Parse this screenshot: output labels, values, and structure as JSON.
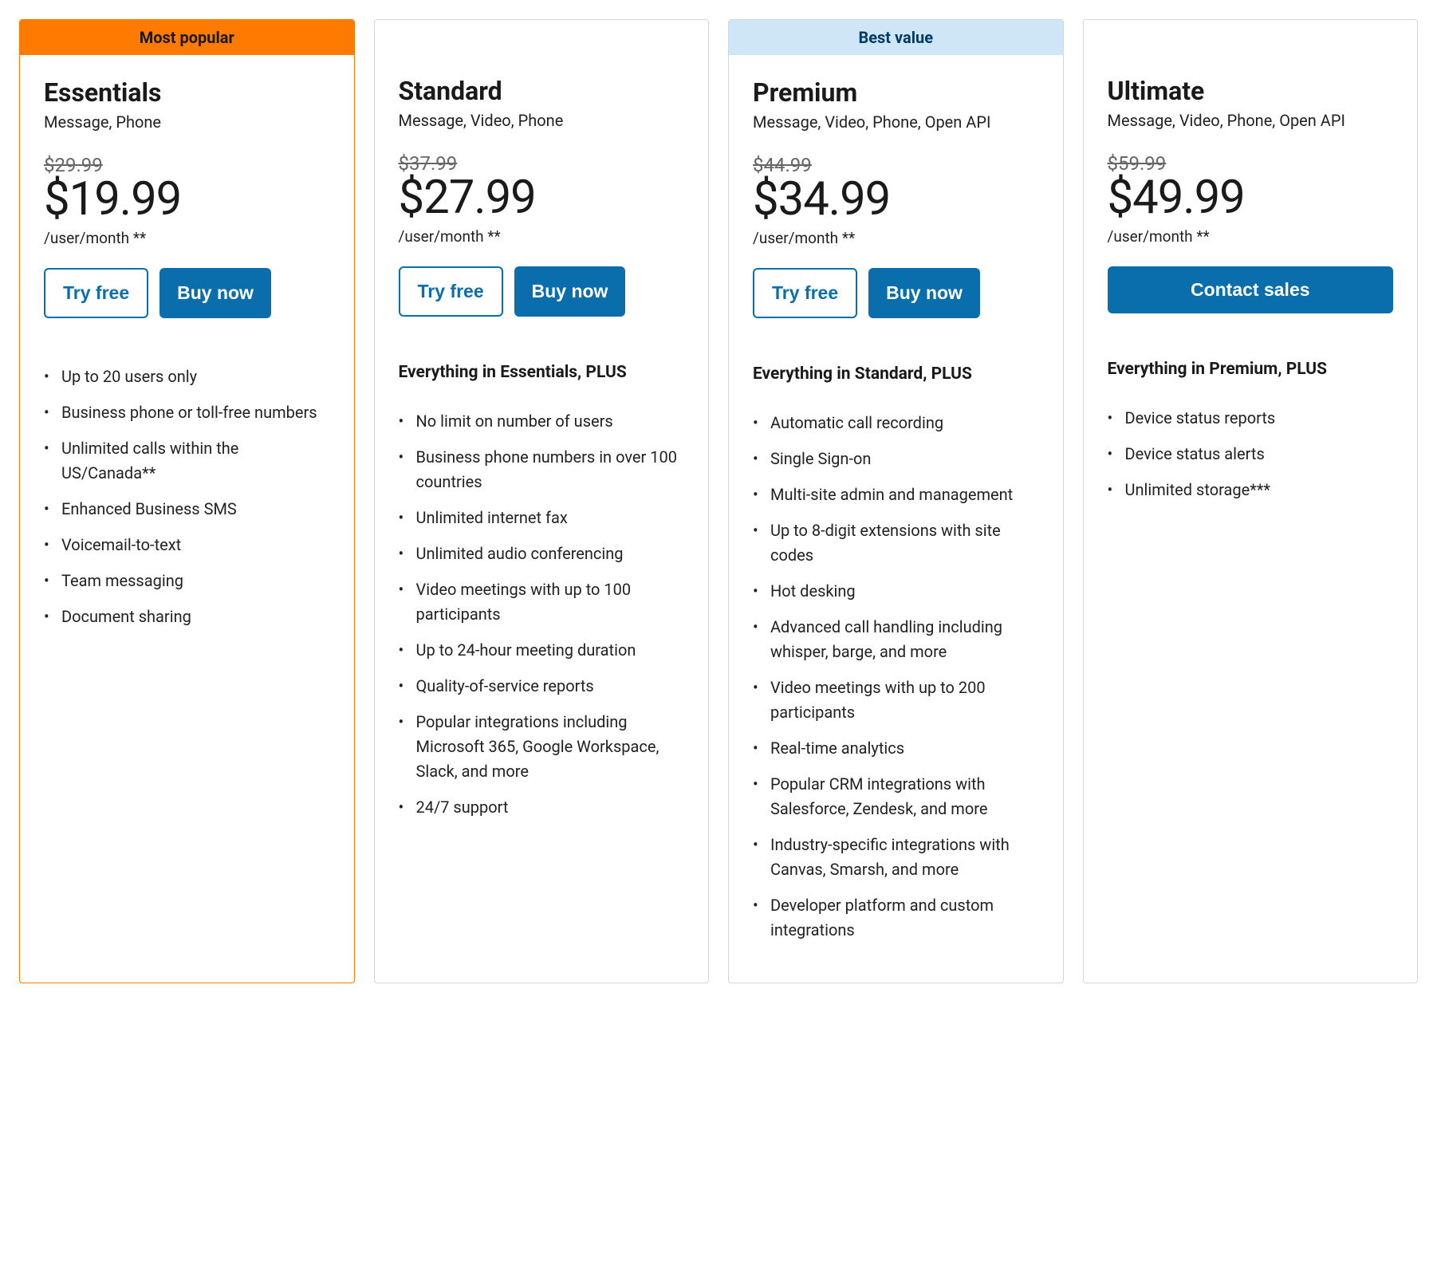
{
  "plans": [
    {
      "badge": "Most popular",
      "badge_style": "orange",
      "highlight": true,
      "name": "Essentials",
      "tagline": "Message, Phone",
      "old_price": "$29.99",
      "price": "$19.99",
      "price_unit": "/user/month **",
      "try_label": "Try free",
      "buy_label": "Buy now",
      "contact_label": "",
      "plus_heading": "",
      "features": [
        "Up to 20 users only",
        "Business phone or toll-free numbers",
        "Unlimited calls within the US/Canada**",
        "Enhanced Business SMS",
        "Voicemail-to-text",
        "Team messaging",
        "Document sharing"
      ]
    },
    {
      "badge": "",
      "badge_style": "",
      "highlight": false,
      "name": "Standard",
      "tagline": "Message, Video, Phone",
      "old_price": "$37.99",
      "price": "$27.99",
      "price_unit": "/user/month **",
      "try_label": "Try free",
      "buy_label": "Buy now",
      "contact_label": "",
      "plus_heading": "Everything in Essentials, PLUS",
      "features": [
        "No limit on number of users",
        "Business phone numbers in over 100 countries",
        "Unlimited internet fax",
        "Unlimited audio conferencing",
        "Video meetings with up to 100 participants",
        "Up to 24-hour meeting duration",
        "Quality-of-service reports",
        "Popular integrations including Microsoft 365, Google Workspace, Slack, and more",
        "24/7 support"
      ]
    },
    {
      "badge": "Best value",
      "badge_style": "blue",
      "highlight": false,
      "name": "Premium",
      "tagline": "Message, Video, Phone, Open API",
      "old_price": "$44.99",
      "price": "$34.99",
      "price_unit": "/user/month **",
      "try_label": "Try free",
      "buy_label": "Buy now",
      "contact_label": "",
      "plus_heading": "Everything in Standard, PLUS",
      "features": [
        "Automatic call recording",
        "Single Sign-on",
        "Multi-site admin and management",
        "Up to 8-digit extensions with site codes",
        "Hot desking",
        "Advanced call handling including whisper, barge, and more",
        "Video meetings with up to 200 participants",
        "Real-time analytics",
        "Popular CRM integrations with Salesforce, Zendesk, and more",
        "Industry-specific integrations with Canvas, Smarsh, and more",
        "Developer platform and custom integrations"
      ]
    },
    {
      "badge": "",
      "badge_style": "",
      "highlight": false,
      "name": "Ultimate",
      "tagline": "Message, Video, Phone, Open API",
      "old_price": "$59.99",
      "price": "$49.99",
      "price_unit": "/user/month **",
      "try_label": "",
      "buy_label": "",
      "contact_label": "Contact sales",
      "plus_heading": "Everything in Premium, PLUS",
      "features": [
        "Device status reports",
        "Device status alerts",
        "Unlimited storage***"
      ]
    }
  ]
}
